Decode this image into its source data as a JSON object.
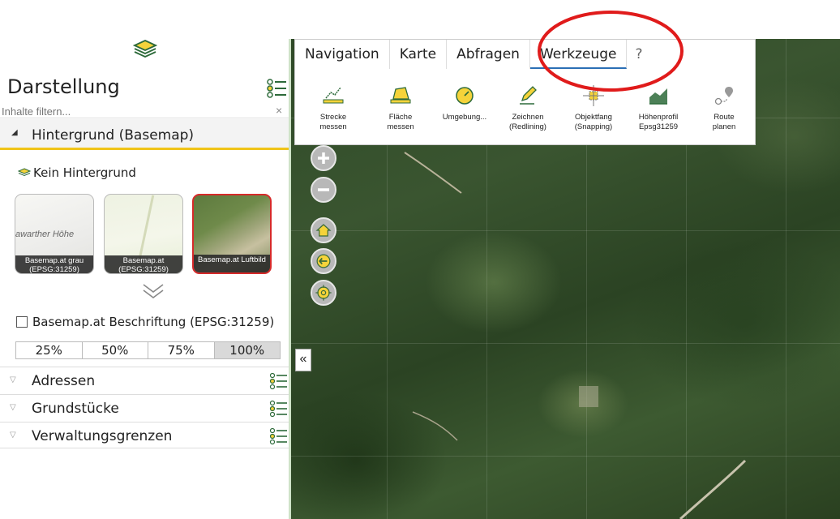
{
  "sidebar": {
    "title": "Darstellung",
    "filter_placeholder": "Inhalte filtern...",
    "filter_clear": "×",
    "basemap_section": "Hintergrund (Basemap)",
    "no_background": "Kein Hintergrund",
    "thumbnails": [
      {
        "label": "Basemap.at grau (EPSG:31259)",
        "map_text": "awarther Höhe"
      },
      {
        "label": "Basemap.at (EPSG:31259)"
      },
      {
        "label": "Basemap.at Luftbild",
        "selected": true
      }
    ],
    "labels_toggle": "Basemap.at Beschriftung (EPSG:31259)",
    "opacity_options": [
      "25%",
      "50%",
      "75%",
      "100%"
    ],
    "opacity_selected": "100%",
    "sections": [
      "Adressen",
      "Grundstücke",
      "Verwaltungsgrenzen"
    ]
  },
  "map": {
    "collapse_label": "«",
    "controls": [
      "zoom-in",
      "zoom-out",
      "home",
      "back",
      "locate"
    ]
  },
  "toolbar": {
    "tabs": [
      "Navigation",
      "Karte",
      "Abfragen",
      "Werkzeuge",
      "?"
    ],
    "active_tab": "Werkzeuge",
    "tools": [
      {
        "line1": "Strecke",
        "line2": "messen"
      },
      {
        "line1": "Fläche",
        "line2": "messen"
      },
      {
        "line1": "Umgebung...",
        "line2": ""
      },
      {
        "line1": "Zeichnen",
        "line2": "(Redlining)"
      },
      {
        "line1": "Objektfang",
        "line2": "(Snapping)"
      },
      {
        "line1": "Höhenprofil",
        "line2": "Epsg31259"
      },
      {
        "line1": "Route",
        "line2": "planen"
      }
    ]
  },
  "colors": {
    "accent_yellow": "#f0c419",
    "active_tab_blue": "#2b6fb5",
    "highlight_red": "#e01b1b",
    "selected_thumb_border": "#d62a2a"
  }
}
